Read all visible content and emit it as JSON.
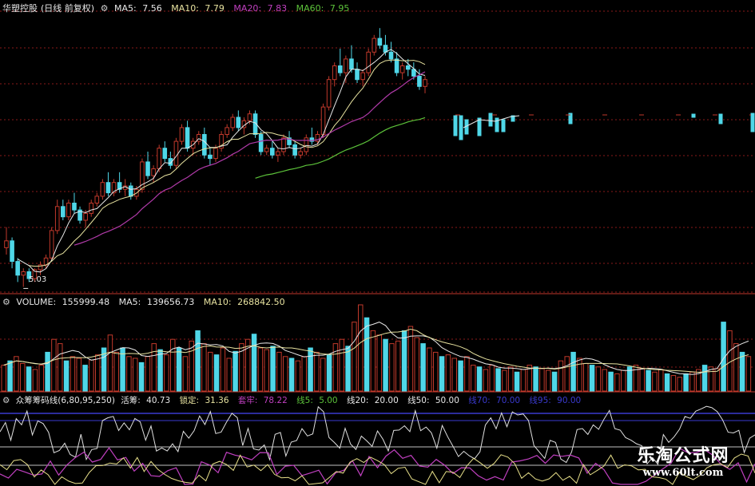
{
  "colors": {
    "up": "#c0392b",
    "down": "#4fd7e8",
    "ma5": "#e8e8e8",
    "ma10": "#e8e3a0",
    "ma20": "#b03aa8",
    "ma60": "#5cc23a",
    "grid": "#8a1a1a",
    "vol_ma5": "#e8e8e8",
    "vol_ma10": "#e8e3a0",
    "ind_white": "#e0e0e0",
    "ind_purple": "#c040c0",
    "ind_yellow": "#e8e08a",
    "ind_blue": "#3a3ad0"
  },
  "price_panel": {
    "name": "华塑控股",
    "period": "(日线 前复权)",
    "icon": "gear-icon",
    "ma5_label": "MA5:",
    "ma5_value": "7.56",
    "ma10_label": "MA10:",
    "ma10_value": "7.79",
    "ma20_label": "MA20:",
    "ma20_value": "7.83",
    "ma60_label": "MA60:",
    "ma60_value": "7.95",
    "low_marker": "5.03"
  },
  "volume_panel": {
    "title": "VOLUME:",
    "value": "155999.48",
    "ma5_label": "MA5:",
    "ma5_value": "139656.73",
    "ma10_label": "MA10:",
    "ma10_value": "268842.50"
  },
  "indicator_panel": {
    "name": "众筹筹码线(6,80,95,250)",
    "huochou_label": "活筹:",
    "huochou_value": "40.73",
    "suoding_label": "锁定:",
    "suoding_value": "31.36",
    "laogu_label": "套牢:",
    "laogu_value": "78.22",
    "line5_label": "线5:",
    "line5_value": "5.00",
    "line20_label": "线20:",
    "line20_value": "20.00",
    "line50_label": "线50:",
    "line50_value": "50.00",
    "line70_label": "线70:",
    "line70_value": "70.00",
    "line95_label": "线95:",
    "line95_value": "90.00"
  },
  "watermark": {
    "line1": "乐淘公式网",
    "line2": "www.60lt.com"
  },
  "chart_data": [
    {
      "type": "candlestick",
      "ylim": [
        5.0,
        9.0
      ],
      "low_label": 5.03,
      "candles": [
        [
          5.6,
          5.9,
          5.5,
          5.7
        ],
        [
          5.7,
          5.75,
          5.3,
          5.4
        ],
        [
          5.4,
          5.45,
          5.1,
          5.2
        ],
        [
          5.2,
          5.3,
          5.03,
          5.25
        ],
        [
          5.25,
          5.3,
          5.1,
          5.15
        ],
        [
          5.15,
          5.3,
          5.1,
          5.28
        ],
        [
          5.28,
          5.4,
          5.2,
          5.35
        ],
        [
          5.35,
          5.5,
          5.3,
          5.45
        ],
        [
          5.45,
          5.9,
          5.4,
          5.85
        ],
        [
          5.85,
          6.3,
          5.8,
          6.2
        ],
        [
          6.2,
          6.3,
          6.0,
          6.05
        ],
        [
          6.05,
          6.3,
          6.0,
          6.25
        ],
        [
          6.25,
          6.4,
          6.1,
          6.15
        ],
        [
          6.15,
          6.2,
          5.95,
          6.0
        ],
        [
          6.0,
          6.15,
          5.9,
          6.1
        ],
        [
          6.1,
          6.3,
          6.05,
          6.25
        ],
        [
          6.25,
          6.4,
          6.2,
          6.35
        ],
        [
          6.35,
          6.6,
          6.3,
          6.55
        ],
        [
          6.55,
          6.7,
          6.35,
          6.4
        ],
        [
          6.4,
          6.6,
          6.35,
          6.55
        ],
        [
          6.55,
          6.7,
          6.4,
          6.45
        ],
        [
          6.45,
          6.6,
          6.35,
          6.5
        ],
        [
          6.5,
          6.55,
          6.3,
          6.35
        ],
        [
          6.35,
          6.5,
          6.3,
          6.45
        ],
        [
          6.45,
          6.9,
          6.4,
          6.85
        ],
        [
          6.85,
          7.0,
          6.6,
          6.65
        ],
        [
          6.65,
          6.8,
          6.55,
          6.75
        ],
        [
          6.75,
          7.1,
          6.7,
          7.05
        ],
        [
          7.05,
          7.15,
          6.85,
          6.9
        ],
        [
          6.9,
          7.0,
          6.75,
          6.8
        ],
        [
          6.8,
          7.2,
          6.75,
          7.15
        ],
        [
          7.15,
          7.4,
          7.1,
          7.35
        ],
        [
          7.35,
          7.45,
          7.0,
          7.05
        ],
        [
          7.05,
          7.2,
          6.95,
          7.15
        ],
        [
          7.15,
          7.3,
          7.1,
          7.25
        ],
        [
          7.25,
          7.35,
          6.9,
          6.95
        ],
        [
          6.95,
          7.05,
          6.8,
          6.9
        ],
        [
          6.9,
          7.1,
          6.85,
          7.05
        ],
        [
          7.05,
          7.3,
          7.0,
          7.25
        ],
        [
          7.25,
          7.4,
          7.2,
          7.35
        ],
        [
          7.35,
          7.55,
          7.3,
          7.5
        ],
        [
          7.5,
          7.6,
          7.3,
          7.35
        ],
        [
          7.35,
          7.5,
          7.25,
          7.45
        ],
        [
          7.45,
          7.6,
          7.4,
          7.55
        ],
        [
          7.55,
          7.6,
          7.2,
          7.25
        ],
        [
          7.25,
          7.3,
          6.95,
          7.0
        ],
        [
          7.0,
          7.1,
          6.95,
          7.05
        ],
        [
          7.05,
          7.15,
          6.9,
          6.95
        ],
        [
          6.95,
          7.05,
          6.85,
          7.0
        ],
        [
          7.0,
          7.25,
          6.95,
          7.2
        ],
        [
          7.2,
          7.3,
          7.05,
          7.1
        ],
        [
          7.1,
          7.15,
          6.9,
          6.95
        ],
        [
          6.95,
          7.05,
          6.9,
          7.0
        ],
        [
          7.0,
          7.25,
          6.95,
          7.2
        ],
        [
          7.2,
          7.35,
          7.1,
          7.15
        ],
        [
          7.15,
          7.3,
          7.1,
          7.25
        ],
        [
          7.25,
          7.7,
          7.2,
          7.65
        ],
        [
          7.65,
          8.1,
          7.6,
          8.05
        ],
        [
          8.05,
          8.3,
          7.95,
          8.25
        ],
        [
          8.25,
          8.5,
          8.1,
          8.15
        ],
        [
          8.15,
          8.4,
          8.0,
          8.35
        ],
        [
          8.35,
          8.55,
          8.15,
          8.2
        ],
        [
          8.2,
          8.3,
          8.0,
          8.05
        ],
        [
          8.05,
          8.2,
          7.95,
          8.15
        ],
        [
          8.15,
          8.5,
          8.1,
          8.45
        ],
        [
          8.45,
          8.7,
          8.4,
          8.65
        ],
        [
          8.65,
          8.8,
          8.5,
          8.55
        ],
        [
          8.55,
          8.7,
          8.4,
          8.45
        ],
        [
          8.45,
          8.6,
          8.3,
          8.35
        ],
        [
          8.35,
          8.45,
          8.1,
          8.15
        ],
        [
          8.15,
          8.3,
          8.05,
          8.25
        ],
        [
          8.25,
          8.35,
          8.1,
          8.2
        ],
        [
          8.2,
          8.3,
          8.05,
          8.1
        ],
        [
          8.1,
          8.2,
          7.9,
          7.95
        ],
        [
          7.95,
          8.1,
          7.85,
          8.05
        ]
      ]
    },
    {
      "type": "bar",
      "title": "VOLUME",
      "note": "relative volume series (first panel section); gap in the middle of the price panel",
      "values": [
        30,
        35,
        40,
        32,
        28,
        25,
        30,
        45,
        60,
        55,
        35,
        40,
        38,
        30,
        36,
        42,
        50,
        65,
        45,
        50,
        40,
        38,
        33,
        40,
        55,
        48,
        42,
        60,
        50,
        40,
        58,
        70,
        55,
        45,
        42,
        50,
        38,
        46,
        55,
        60,
        66,
        50,
        48,
        52,
        45,
        40,
        38,
        35,
        40,
        50,
        45,
        38,
        42,
        55,
        60,
        52,
        80,
        100,
        85,
        70,
        65,
        60,
        55,
        58,
        70,
        75,
        62,
        55,
        50,
        45,
        40,
        42,
        38,
        35,
        40,
        30,
        28,
        25,
        30,
        26,
        24,
        28,
        22,
        25,
        30,
        28,
        26,
        24,
        22,
        35,
        40,
        45,
        38,
        32,
        30,
        28,
        25,
        22,
        20,
        24,
        28,
        30,
        26,
        24,
        22,
        25,
        20,
        18,
        16,
        20,
        22,
        25,
        30,
        28,
        26,
        80,
        70,
        55,
        45,
        40
      ]
    }
  ]
}
